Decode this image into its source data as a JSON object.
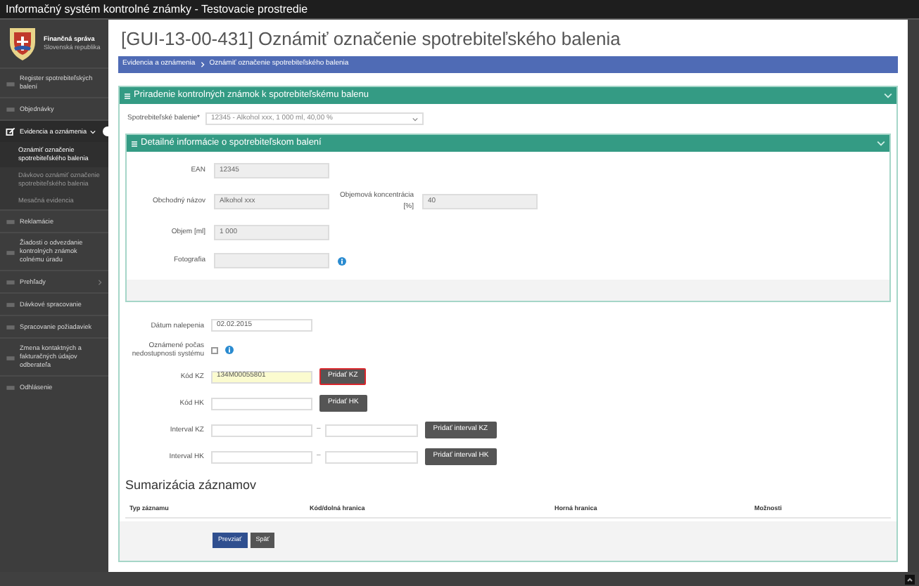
{
  "window": {
    "title": "Informačný systém kontrolné známky - Testovacie prostredie"
  },
  "sidebar": {
    "org_name": "Finančná správa",
    "org_country": "Slovenská republika",
    "items": [
      {
        "label": "Register spotrebiteľských balení",
        "expanded": false,
        "selected": false
      },
      {
        "label": "Objednávky",
        "expanded": false,
        "selected": false
      },
      {
        "label": "Evidencia a oznámenia",
        "expanded": true,
        "selected": true,
        "children": [
          {
            "label": "Oznámiť označenie spotrebiteľského balenia",
            "selected": true
          },
          {
            "label": "Dávkovo oznámiť označenie spotrebiteľského balenia",
            "selected": false
          },
          {
            "label": "Mesačná evidencia",
            "selected": false
          }
        ]
      },
      {
        "label": "Reklamácie",
        "expanded": false,
        "selected": false
      },
      {
        "label": "Žiadosti o odvezdanie kontrolných známok colnému úradu",
        "expanded": false,
        "selected": false
      },
      {
        "label": "Prehľady",
        "expanded": false,
        "selected": false,
        "has_submenu": true
      },
      {
        "label": "Dávkové spracovanie",
        "expanded": false,
        "selected": false
      },
      {
        "label": "Spracovanie požiadaviek",
        "expanded": false,
        "selected": false
      },
      {
        "label": "Zmena kontaktných a fakturačných údajov odberateľa",
        "expanded": false,
        "selected": false
      },
      {
        "label": "Odhlásenie",
        "expanded": false,
        "selected": false
      }
    ]
  },
  "page_title": "[GUI-13-00-431] Oznámiť označenie spotrebiteľského balenia",
  "breadcrumb": [
    "Evidencia a oznámenia",
    "Oznámiť označenie spotrebiteľského balenia"
  ],
  "assignment_panel": {
    "title": "Priradenie kontrolných známok k spotrebiteľskému balenu",
    "package_label": "Spotrebiteľské balenie*",
    "package_value": "12345 - Alkohol xxx, 1 000 ml, 40,00 %"
  },
  "detail_panel": {
    "title": "Detailné informácie o spotrebiteľskom balení",
    "rows": [
      {
        "fields": [
          {
            "label": "EAN",
            "value": "12345"
          }
        ]
      },
      {
        "fields": [
          {
            "label": "Obchodný názov",
            "value": "Alkohol xxx"
          },
          {
            "label": "Objemová koncentrácia [%]",
            "value": "40"
          }
        ]
      },
      {
        "fields": [
          {
            "label": "Objem [ml]",
            "value": "1 000"
          }
        ]
      },
      {
        "fields": [
          {
            "label": "Fotografia",
            "info": true
          }
        ]
      }
    ]
  },
  "form": [
    {
      "kind": "text",
      "label": "Dátum nalepenia",
      "value": "02.02.2015"
    },
    {
      "kind": "checkbox",
      "label": "Oznámené počas nedostupnosti systému",
      "checked": false,
      "info": true
    },
    {
      "kind": "text",
      "label": "Kód KZ",
      "value": "134M00055801",
      "highlighted": true,
      "button": {
        "label": "Pridať KZ",
        "focused": true
      }
    },
    {
      "kind": "text",
      "label": "Kód HK",
      "highlighted": false,
      "button": {
        "label": "Pridať HK",
        "focused": false
      }
    },
    {
      "kind": "interval",
      "label": "Interval KZ",
      "separator": "–",
      "button": {
        "label": "Pridať interval KZ",
        "focused": false
      }
    },
    {
      "kind": "interval",
      "label": "Interval HK",
      "separator": "–",
      "button": {
        "label": "Pridať interval HK",
        "focused": false
      }
    }
  ],
  "summary": {
    "title": "Sumarizácia záznamov",
    "columns": [
      "Typ záznamu",
      "Kód/dolná hranica",
      "Horná hranica",
      "Možnosti"
    ]
  },
  "actions": [
    {
      "label": "Prevziať",
      "kind": "primary"
    },
    {
      "label": "Späť",
      "kind": "secondary"
    }
  ]
}
